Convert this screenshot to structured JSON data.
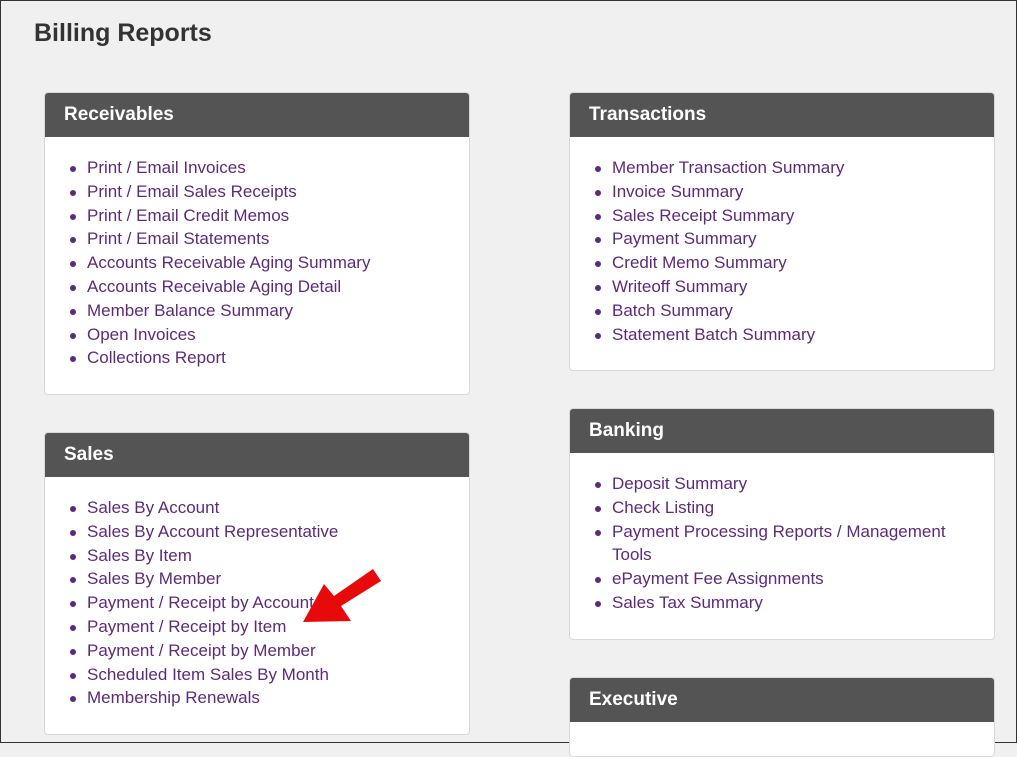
{
  "page_title": "Billing Reports",
  "panels": {
    "receivables": {
      "title": "Receivables",
      "items": [
        "Print / Email Invoices",
        "Print / Email Sales Receipts",
        "Print / Email Credit Memos",
        "Print / Email Statements",
        "Accounts Receivable Aging Summary",
        "Accounts Receivable Aging Detail",
        "Member Balance Summary",
        "Open Invoices",
        "Collections Report"
      ]
    },
    "sales": {
      "title": "Sales",
      "items": [
        "Sales By Account",
        "Sales By Account Representative",
        "Sales By Item",
        "Sales By Member",
        "Payment / Receipt by Account",
        "Payment / Receipt by Item",
        "Payment / Receipt by Member",
        "Scheduled Item Sales By Month",
        "Membership Renewals"
      ]
    },
    "transactions": {
      "title": "Transactions",
      "items": [
        "Member Transaction Summary",
        "Invoice Summary",
        "Sales Receipt Summary",
        "Payment Summary",
        "Credit Memo Summary",
        "Writeoff Summary",
        "Batch Summary",
        "Statement Batch Summary"
      ]
    },
    "banking": {
      "title": "Banking",
      "items": [
        "Deposit Summary",
        "Check Listing",
        "Payment Processing Reports / Management Tools",
        "ePayment Fee Assignments",
        "Sales Tax Summary"
      ]
    },
    "executive": {
      "title": "Executive",
      "items": []
    }
  },
  "colors": {
    "link": "#5d2a7a",
    "header": "#545454",
    "arrow": "#e80a0a"
  }
}
